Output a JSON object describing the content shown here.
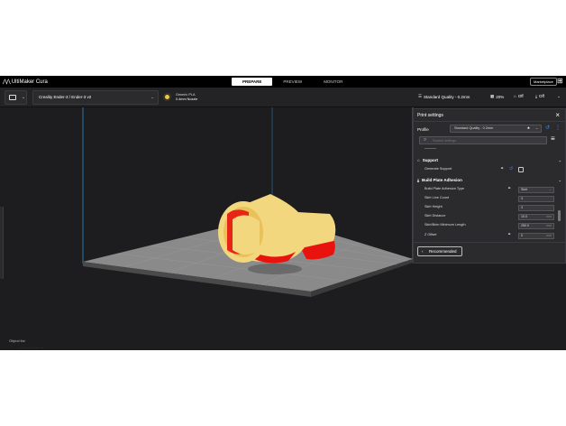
{
  "app": {
    "title": "UltiMaker Cura",
    "marketplace": "Marketplace"
  },
  "stages": [
    {
      "label": "PREPARE",
      "active": true
    },
    {
      "label": "PREVIEW",
      "active": false
    },
    {
      "label": "MONITOR",
      "active": false
    }
  ],
  "toolbar": {
    "printer": "Creality Ender-3 / Ender-3 v2",
    "material_name": "Generic PLA",
    "nozzle": "0.4mm Nozzle",
    "material_color": "#f2c34a",
    "quality": "Standard Quality - 0.2mm",
    "infill": "20%",
    "support": "Off",
    "adhesion": "Off"
  },
  "panel": {
    "title": "Print settings",
    "profile_label": "Profile",
    "profile_value": "Standard Quality - 0.2mm",
    "search_placeholder": "Search settings",
    "categories": {
      "support": "Support",
      "adhesion": "Build Plate Adhesion"
    },
    "settings": {
      "generate_support": "Generate Support",
      "adhesion_type": {
        "label": "Build Plate Adhesion Type",
        "value": "Skirt"
      },
      "skirt_line_count": {
        "label": "Skirt Line Count",
        "value": "3"
      },
      "skirt_height": {
        "label": "Skirt Height",
        "value": "3"
      },
      "skirt_distance": {
        "label": "Skirt Distance",
        "value": "10.0",
        "unit": "mm"
      },
      "skirt_min_length": {
        "label": "Skirt/Brim Minimum Length",
        "value": "250.0",
        "unit": "mm"
      },
      "z_offset": {
        "label": "Z Offset",
        "value": "0",
        "unit": "mm"
      }
    },
    "recommended": "Recommended"
  },
  "viewport": {
    "object_list_label": "Object list"
  },
  "colors": {
    "accent": "#3b8cff",
    "object": "#f2d77e",
    "overhang": "#e8130f"
  }
}
